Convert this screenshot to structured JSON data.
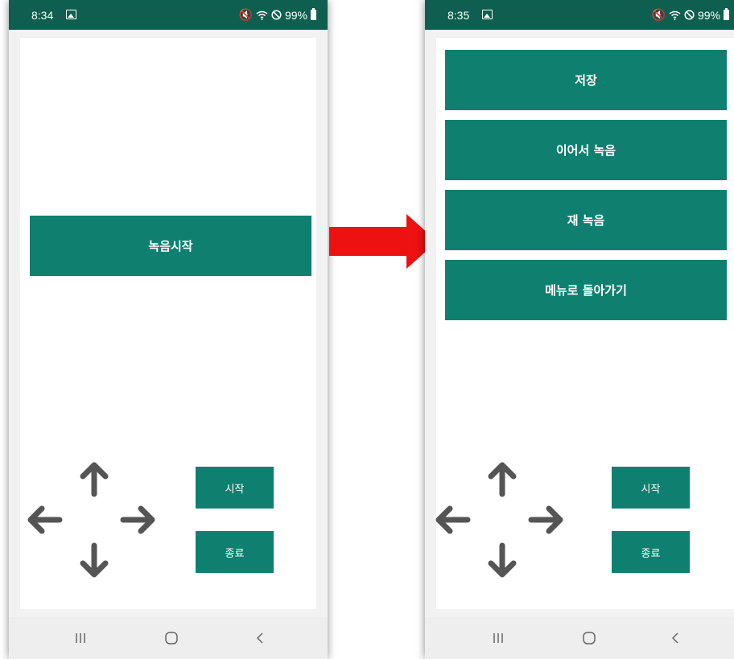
{
  "left_phone": {
    "status": {
      "time": "8:34",
      "battery": "99%"
    },
    "record_start_label": "녹음시작",
    "start_label": "시작",
    "stop_label": "종료"
  },
  "right_phone": {
    "status": {
      "time": "8:35",
      "battery": "99%"
    },
    "menu": [
      {
        "label": "저장"
      },
      {
        "label": "이어서 녹음"
      },
      {
        "label": "재 녹음"
      },
      {
        "label": "메뉴로 돌아가기"
      }
    ],
    "start_label": "시작",
    "stop_label": "종료"
  },
  "icons": {
    "status": [
      "gallery-icon",
      "mute-icon",
      "wifi-icon",
      "do-not-disturb-icon",
      "battery-icon"
    ],
    "dpad": [
      "arrow-up-icon",
      "arrow-left-icon",
      "arrow-right-icon",
      "arrow-down-icon"
    ],
    "nav": [
      "recent-apps-icon",
      "home-icon",
      "back-icon"
    ],
    "transition": "red-arrow-right-icon"
  },
  "colors": {
    "status_bar": "#0e5f4f",
    "button": "#0f8070",
    "arrow_gray": "#555555",
    "transition_arrow": "#ee1111"
  }
}
